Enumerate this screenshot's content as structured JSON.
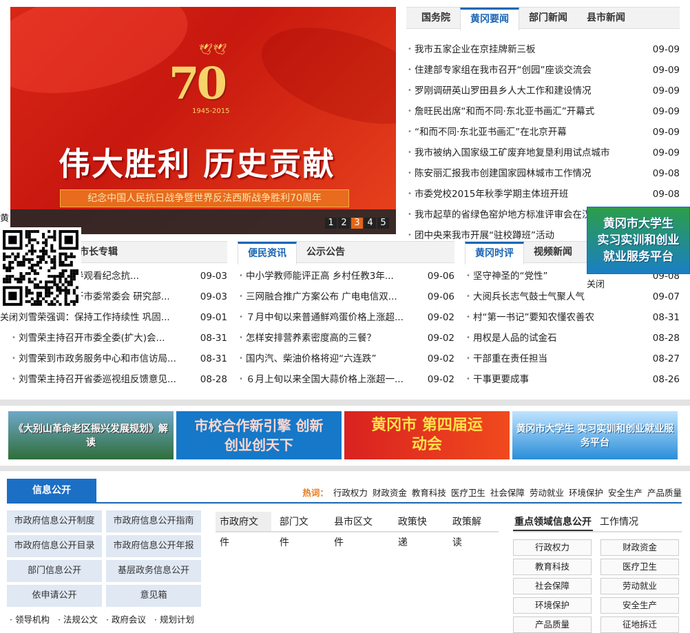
{
  "banner": {
    "badge_number": "70",
    "badge_years": "1945-2015",
    "headline": "伟大胜利 历史贡献",
    "subtitle": "纪念中国人民抗日战争暨世界反法西斯战争胜利70周年",
    "pages": [
      "1",
      "2",
      "3",
      "4",
      "5"
    ],
    "active_page": "3"
  },
  "top_news": {
    "tabs": [
      "国务院",
      "黄冈要闻",
      "部门新闻",
      "县市新闻"
    ],
    "active_tab": "黄冈要闻",
    "items": [
      {
        "title": "我市五家企业在京挂牌新三板",
        "date": "09-09"
      },
      {
        "title": "住建部专家组在我市召开“创园”座谈交流会",
        "date": "09-09"
      },
      {
        "title": "罗刚调研英山罗田县乡人大工作和建设情况",
        "date": "09-09"
      },
      {
        "title": "詹旺民出席“和而不同·东北亚书画汇”开幕式",
        "date": "09-09"
      },
      {
        "title": "“和而不同·东北亚书画汇”在北京开幕",
        "date": "09-09"
      },
      {
        "title": "我市被纳入国家级工矿废弃地复垦利用试点城市",
        "date": "09-09"
      },
      {
        "title": "陈安丽汇报我市创建国家园林城市工作情况",
        "date": "09-08"
      },
      {
        "title": "市委党校2015年秋季学期主体班开班",
        "date": "09-08"
      },
      {
        "title": "我市起草的省绿色窑炉地方标准评审会在汉举行",
        "date": "09-08"
      },
      {
        "title": "团中央来我市开展“驻校蹲班”活动",
        "date": ""
      }
    ]
  },
  "mayor": {
    "tab": "市长专辑",
    "items": [
      {
        "title": "刘雪荣等市领导观看纪念抗...",
        "date": "09-03"
      },
      {
        "title": "刘雪荣主持召开市委常委会 研究部...",
        "date": "09-03"
      },
      {
        "title": "刘雪荣强调：保持工作持续性 巩固...",
        "date": "09-01"
      },
      {
        "title": "刘雪荣主持召开市委全委(扩大)会...",
        "date": "08-31"
      },
      {
        "title": "刘雪荣到市政务服务中心和市信访局...",
        "date": "08-31"
      },
      {
        "title": "刘雪荣主持召开省委巡视组反馈意见...",
        "date": "08-28"
      }
    ]
  },
  "convenience": {
    "tabs": [
      "便民资讯",
      "公示公告"
    ],
    "active_tab": "便民资讯",
    "items": [
      {
        "title": "中小学教师能评正高 乡村任教3年...",
        "date": "09-06"
      },
      {
        "title": "三网融合推广方案公布 广电电信双...",
        "date": "09-06"
      },
      {
        "title": "７月中旬以来普通鲜鸡蛋价格上涨超...",
        "date": "09-02"
      },
      {
        "title": "怎样安排营养素密度高的三餐？",
        "date": "09-02"
      },
      {
        "title": "国内汽、柴油价格将迎“六连跌”",
        "date": "09-02"
      },
      {
        "title": "６月上旬以来全国大蒜价格上涨超一...",
        "date": "09-02"
      }
    ]
  },
  "commentary": {
    "tabs": [
      "黄冈时评",
      "视频新闻"
    ],
    "active_tab": "黄冈时评",
    "items": [
      {
        "title": "坚守神圣的“党性”",
        "date": "09-08"
      },
      {
        "title": "大阅兵长志气鼓士气聚人气",
        "date": "09-07"
      },
      {
        "title": "村“第一书记”要知农懂农善农",
        "date": "08-31"
      },
      {
        "title": "用权是人品的试金石",
        "date": "08-28"
      },
      {
        "title": "干部重在责任担当",
        "date": "08-27"
      },
      {
        "title": "干事更要成事",
        "date": "08-26"
      }
    ]
  },
  "floating": {
    "qr_close": "关闭",
    "ad_lines": [
      "黄冈市大学生",
      "实习实训和创业",
      "就业服务平台"
    ],
    "ad_close": "关闭",
    "left_edge_char": "黄"
  },
  "ads": [
    {
      "text": "《大别山革命老区振兴发展规划》解读"
    },
    {
      "text": "市校合作新引擎 创新创业创天下"
    },
    {
      "text": "黄冈市 第四届运动会"
    },
    {
      "text": "黄冈市大学生 实习实训和创业就业服务平台"
    }
  ],
  "info": {
    "title": "信息公开",
    "hot_label": "热词：",
    "hot_words": [
      "行政权力",
      "财政资金",
      "教育科技",
      "医疗卫生",
      "社会保障",
      "劳动就业",
      "环境保护",
      "安全生产",
      "产品质量"
    ],
    "buttons": [
      "市政府信息公开制度",
      "市政府信息公开指南",
      "市政府信息公开目录",
      "市政府信息公开年报",
      "部门信息公开",
      "基层政务信息公开",
      "依申请公开",
      "意见箱"
    ],
    "links": [
      "领导机构",
      "法规公文",
      "政府会议",
      "规划计划"
    ],
    "doc_tabs": [
      "市政府文件",
      "部门文件",
      "县市区文件",
      "政策快递",
      "政策解读"
    ],
    "active_doc_tab": "市政府文件",
    "key_tabs": [
      "重点领域信息公开",
      "工作情况"
    ],
    "key_buttons": [
      "行政权力",
      "财政资金",
      "教育科技",
      "医疗卫生",
      "社会保障",
      "劳动就业",
      "环境保护",
      "安全生产",
      "产品质量",
      "征地拆迁"
    ]
  },
  "colors": {
    "accent": "#1966b5",
    "banner_red": "#d92617",
    "active_page": "#e3661a",
    "hot_label": "#e5791c"
  }
}
